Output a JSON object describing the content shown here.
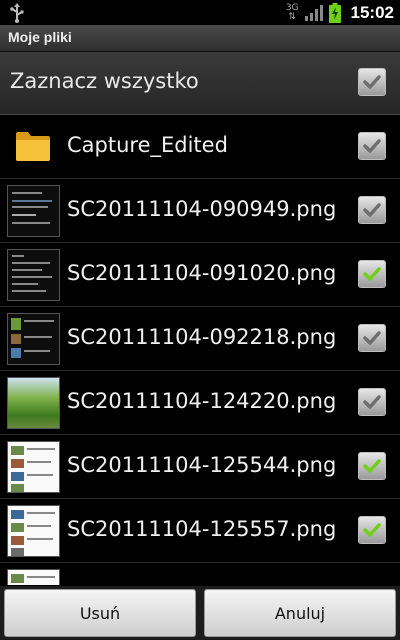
{
  "status_bar": {
    "network": "3G",
    "time": "15:02",
    "icons": [
      "usb-icon",
      "signal-icon",
      "battery-charging-icon"
    ]
  },
  "title_bar": {
    "title": "Moje pliki"
  },
  "select_all": {
    "label": "Zaznacz wszystko",
    "checked": false
  },
  "files": [
    {
      "name": "Capture_Edited",
      "type": "folder",
      "checked": false
    },
    {
      "name": "SC20111104-090949.png",
      "type": "image",
      "checked": false
    },
    {
      "name": "SC20111104-091020.png",
      "type": "image",
      "checked": true
    },
    {
      "name": "SC20111104-092218.png",
      "type": "image",
      "checked": false
    },
    {
      "name": "SC20111104-124220.png",
      "type": "image",
      "checked": false
    },
    {
      "name": "SC20111104-125544.png",
      "type": "image",
      "checked": true
    },
    {
      "name": "SC20111104-125557.png",
      "type": "image",
      "checked": true
    }
  ],
  "buttons": {
    "delete_label": "Usuń",
    "cancel_label": "Anuluj"
  },
  "colors": {
    "check_active": "#6fcf1a",
    "check_inactive": "#6e6e6e",
    "title_bar": "#3b3b3b",
    "background": "#000000"
  }
}
